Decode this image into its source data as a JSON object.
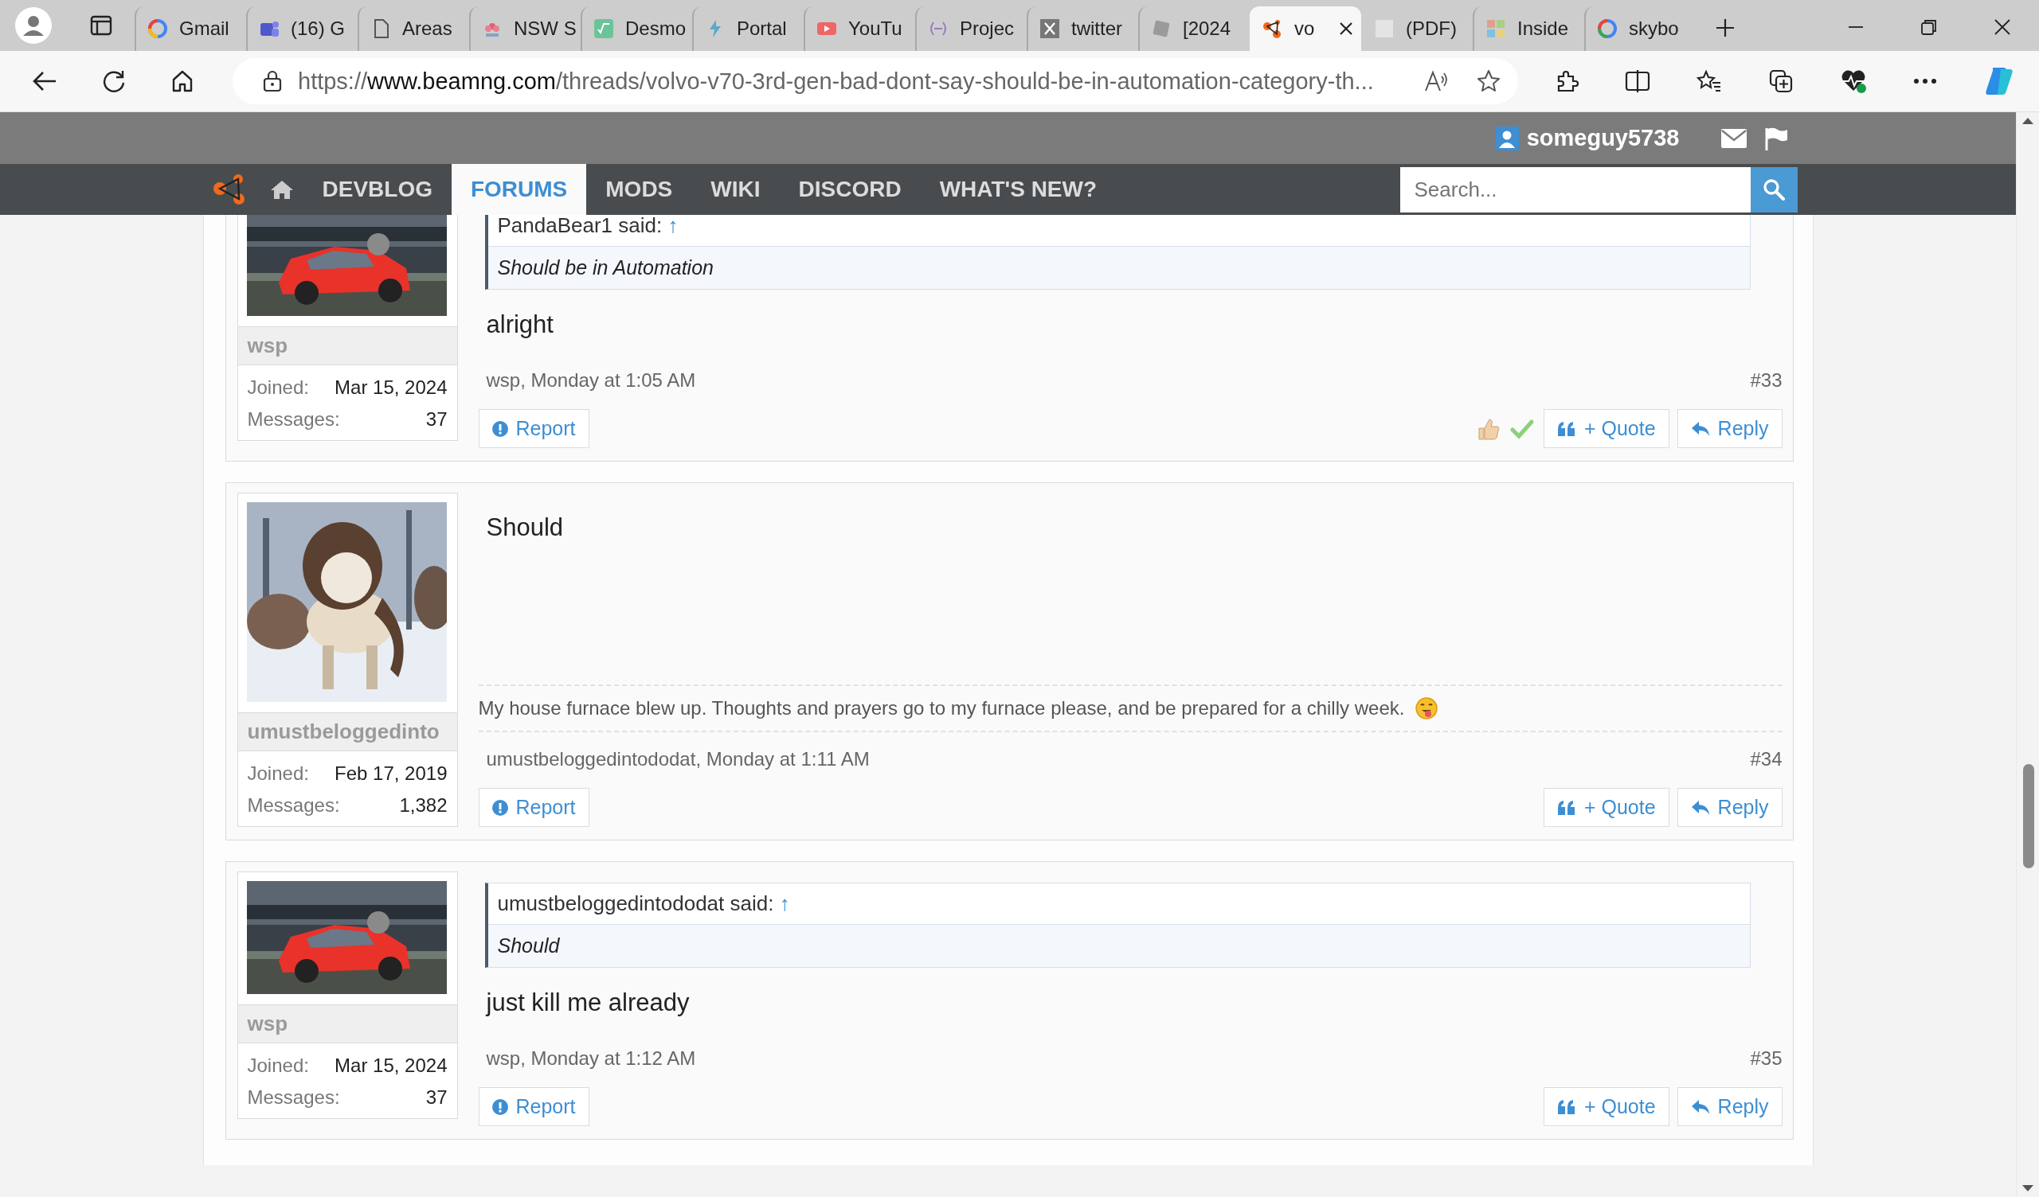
{
  "browser": {
    "tabs": [
      {
        "title": "Gmail",
        "selected": false
      },
      {
        "title": "(16) G",
        "selected": false
      },
      {
        "title": "Areas",
        "selected": false
      },
      {
        "title": "NSW S",
        "selected": false
      },
      {
        "title": "Desmo",
        "selected": false
      },
      {
        "title": "Portal",
        "selected": false
      },
      {
        "title": "YouTu",
        "selected": false
      },
      {
        "title": "Projec",
        "selected": false
      },
      {
        "title": "twitter",
        "selected": false
      },
      {
        "title": "[2024",
        "selected": false
      },
      {
        "title": "vo",
        "selected": true
      },
      {
        "title": "(PDF)",
        "selected": false
      },
      {
        "title": "Inside",
        "selected": false
      },
      {
        "title": "skybo",
        "selected": false
      }
    ],
    "url": {
      "scheme": "https://",
      "host": "www.beamng.com",
      "path": "/threads/volvo-v70-3rd-gen-bad-dont-say-should-be-in-automation-category-th..."
    }
  },
  "site": {
    "user": "someguy5738",
    "nav": [
      {
        "label": "DEVBLOG",
        "selected": false
      },
      {
        "label": "FORUMS",
        "selected": true
      },
      {
        "label": "MODS",
        "selected": false
      },
      {
        "label": "WIKI",
        "selected": false
      },
      {
        "label": "DISCORD",
        "selected": false
      },
      {
        "label": "WHAT'S NEW?",
        "selected": false
      }
    ],
    "search": {
      "placeholder": "Search..."
    }
  },
  "posts": [
    {
      "author": "wsp",
      "joined_label": "Joined:",
      "joined": "Mar 15, 2024",
      "messages_label": "Messages:",
      "messages": "37",
      "quote": {
        "header": "PandaBear1 said:",
        "arrow": "↑",
        "text": "Should be in Automation"
      },
      "body": "alright",
      "meta": "wsp, Monday at 1:05 AM",
      "number": "#33",
      "reactions": true,
      "report": "Report",
      "quote_button": "+ Quote",
      "reply": "Reply"
    },
    {
      "author": "umustbeloggedinto",
      "joined_label": "Joined:",
      "joined": "Feb 17, 2019",
      "messages_label": "Messages:",
      "messages": "1,382",
      "body": "Should",
      "signature": "My house furnace blew up. Thoughts and prayers go to my furnace please, and be prepared for a chilly week.",
      "meta": "umustbeloggedintododat, Monday at 1:11 AM",
      "number": "#34",
      "reactions": false,
      "report": "Report",
      "quote_button": "+ Quote",
      "reply": "Reply"
    },
    {
      "author": "wsp",
      "joined_label": "Joined:",
      "joined": "Mar 15, 2024",
      "messages_label": "Messages:",
      "messages": "37",
      "quote": {
        "header": "umustbeloggedintododat said:",
        "arrow": "↑",
        "text": "Should"
      },
      "body": "just kill me already",
      "meta": "wsp, Monday at 1:12 AM",
      "number": "#35",
      "reactions": false,
      "report": "Report",
      "quote_button": "+ Quote",
      "reply": "Reply"
    }
  ]
}
